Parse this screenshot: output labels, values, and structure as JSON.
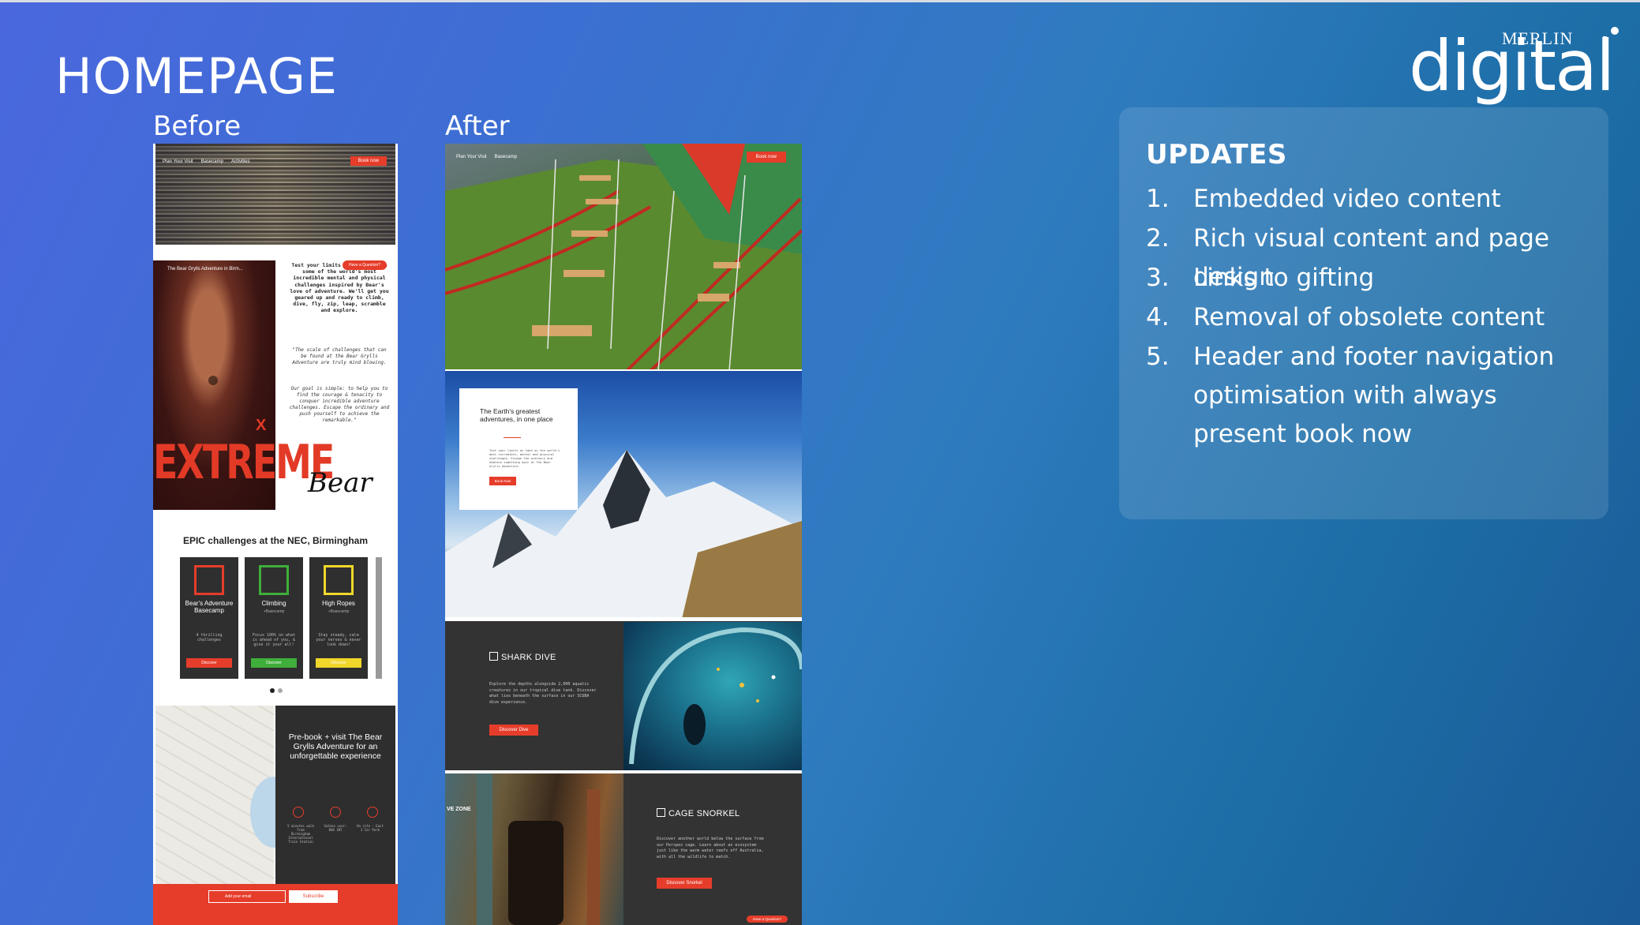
{
  "slide": {
    "title": "HOMEPAGE",
    "logo_small": "MERLIN",
    "logo_large": "digital"
  },
  "before": {
    "label": "Before",
    "nav": [
      "Plan Your Visit",
      "Basecamp",
      "Activities"
    ],
    "book_now": "Book now",
    "video_title": "The Bear Grylls Adventure in Birm...",
    "video_overlay": "EXTREME",
    "intro_text": "Test your limits as you take on some of the world's most incredible mental and physical challenges inspired by Bear's love of adventure. We'll get you geared up and ready to climb, dive, fly, zip, leap, scramble and explore.",
    "quote_text": "\"The scale of challenges that can be found at the Bear Grylls Adventure are truly mind blowing.",
    "goal_text": "Our goal is simple: to help you to find the courage & tenacity to conquer incredible adventure challenges. Escape the ordinary and push yourself to achieve the remarkable.\"",
    "question": "Have a Question?",
    "signature": "Bear",
    "epic_heading": "EPIC challenges at the NEC, Birmingham",
    "cards": [
      {
        "name": "Bear's Adventure Basecamp",
        "desc": "4 thrilling challenges",
        "button": "Discover",
        "color": "#e63d2b"
      },
      {
        "name": "Climbing",
        "sub": "+Basecamp",
        "desc": "Focus 100% on what is ahead of you, & give it your all!",
        "button": "Discover",
        "color": "#3fae3a"
      },
      {
        "name": "High Ropes",
        "sub": "+Basecamp",
        "desc": "Stay steady, calm your nerves & never look down!",
        "button": "Discover",
        "color": "#f1d72a"
      }
    ],
    "prebook_heading": "Pre-book + visit The Bear Grylls Adventure for an unforgettable experience",
    "prebook_info": [
      "5 minutes walk from Birmingham International Train Station",
      "Satnav user: B40 1NT",
      "On site - East 3 Car Park"
    ],
    "email_placeholder": "Add your email",
    "subscribe": "Subscribe"
  },
  "after": {
    "label": "After",
    "nav": [
      "Plan Your Visit",
      "Basecamp"
    ],
    "book_now": "Book now",
    "card_heading": "The Earth's greatest adventures, in one place",
    "card_text": "Test your limits as take on the world's most incredible, mental and physical challenges. Escape the ordinary and embrace something epic at The Bear Grylls Adventure.",
    "card_button": "Book Now",
    "shark_title": "SHARK DIVE",
    "shark_text": "Explore the depths alongside 2,000 aquatic creatures in our tropical dive tank. Discover what lies beneath the surface in our SCUBA dive experience.",
    "shark_button": "Discover Dive",
    "snorkel_title": "CAGE SNORKEL",
    "snorkel_text": "Discover another world below the surface from our Perspex cage. Learn about an ecosystem just like the warm water reefs off Australia, with all the wildlife to match.",
    "snorkel_button": "Discover Snorkel",
    "snorkel_img_text": "VE ZONE",
    "question": "Have a Question?"
  },
  "updates": {
    "title": "UPDATES",
    "items": [
      {
        "num": "1.",
        "text": "Embedded video content"
      },
      {
        "num": "2.",
        "text": "Rich visual content and page design"
      },
      {
        "num": "3.",
        "text": "Links to gifting"
      },
      {
        "num": "4.",
        "text": "Removal of obsolete content"
      },
      {
        "num": "5.",
        "text": "Header and footer navigation optimisation with always present book now"
      }
    ]
  }
}
